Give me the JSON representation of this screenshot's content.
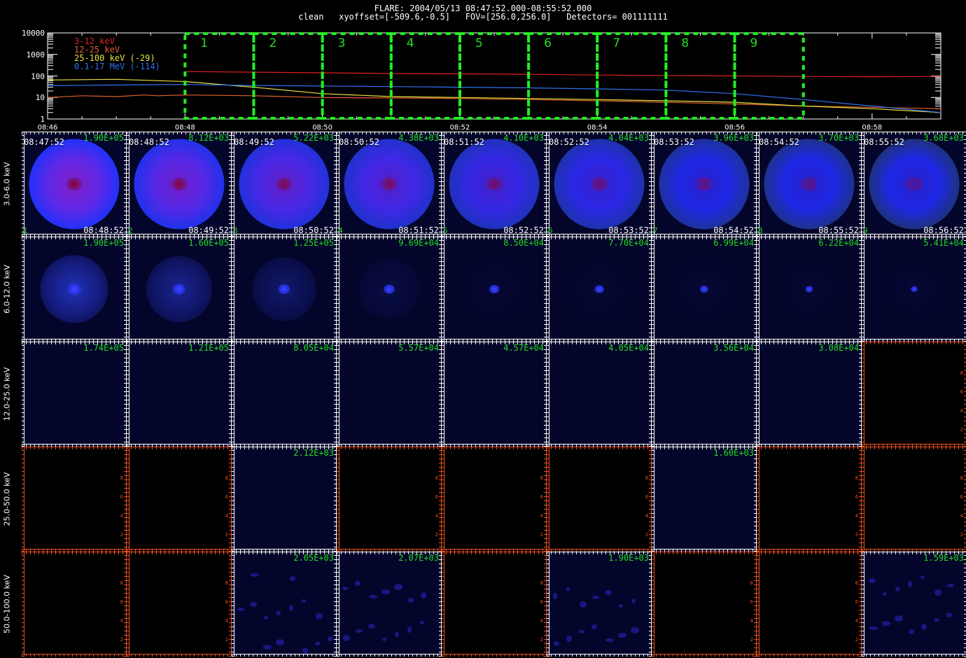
{
  "header": {
    "line1": "FLARE: 2004/05/13 08:47:52.000-08:55:52.000",
    "line2": "clean   xyoffset=[-509.6,-0.5]   FOV=[256.0,256.0]   Detectors= 001111111"
  },
  "chart_data": [
    {
      "type": "line",
      "x_axis": {
        "unit": "time",
        "range": [
          "08:46",
          "08:59"
        ],
        "tick_labels": [
          "08:46",
          "08:48",
          "08:50",
          "08:52",
          "08:54",
          "08:56",
          "08:58"
        ]
      },
      "y_axis": {
        "scale": "log",
        "range": [
          1,
          10000
        ],
        "tick_labels": [
          "1",
          "10",
          "100",
          "1000",
          "10000"
        ]
      },
      "series": [
        {
          "name": "3-12 keV",
          "color": "#dd2222",
          "x": [
            "08:46",
            "08:47",
            "08:48",
            "08:49",
            "08:50",
            "08:51",
            "08:52",
            "08:53",
            "08:54",
            "08:55",
            "08:56",
            "08:57",
            "08:58",
            "08:59"
          ],
          "values": [
            null,
            null,
            160,
            150,
            140,
            130,
            125,
            120,
            110,
            105,
            100,
            95,
            92,
            95
          ]
        },
        {
          "name": "12-25 keV",
          "color": "#e06030",
          "x": [
            "08:46",
            "08:46.5",
            "08:47",
            "08:47.4",
            "08:47.6",
            "08:48",
            "08:49",
            "08:50",
            "08:51",
            "08:52",
            "08:53",
            "08:54",
            "08:55",
            "08:56",
            "08:57",
            "08:58",
            "08:59"
          ],
          "values": [
            10,
            12,
            11,
            13,
            12,
            13,
            12,
            10,
            9.5,
            9,
            8,
            7,
            6,
            5,
            4,
            3.5,
            3
          ]
        },
        {
          "name": "25-100 keV (-29)",
          "color": "#e8e040",
          "x": [
            "08:46",
            "08:47",
            "08:48",
            "08:49",
            "08:50",
            "08:51",
            "08:52",
            "08:53",
            "08:54",
            "08:55",
            "08:56",
            "08:57",
            "08:58",
            "08:59"
          ],
          "values": [
            65,
            70,
            55,
            30,
            15,
            11,
            10,
            9,
            8,
            7,
            6,
            4,
            3,
            2
          ]
        },
        {
          "name": "0.1-17 MeV (-114)",
          "color": "#3070ee",
          "x": [
            "08:46",
            "08:47",
            "08:48",
            "08:49",
            "08:50",
            "08:51",
            "08:52",
            "08:53",
            "08:54",
            "08:55",
            "08:56",
            "08:57",
            "08:58",
            "08:59"
          ],
          "values": [
            35,
            38,
            40,
            36,
            34,
            32,
            30,
            28,
            25,
            22,
            15,
            8,
            4,
            2
          ]
        }
      ],
      "intervals": [
        "1",
        "2",
        "3",
        "4",
        "5",
        "6",
        "7",
        "8",
        "9"
      ],
      "interval_bounds": [
        "08:48",
        "08:49",
        "08:50",
        "08:51",
        "08:52",
        "08:53",
        "08:54",
        "08:55",
        "08:56",
        "08:57"
      ]
    },
    {
      "type": "heatmap",
      "columns": [
        {
          "index": "1",
          "start": "08:47:52",
          "end": "08:48:52"
        },
        {
          "index": "2",
          "start": "08:48:52",
          "end": "08:49:52"
        },
        {
          "index": "3",
          "start": "08:49:52",
          "end": "08:50:52"
        },
        {
          "index": "4",
          "start": "08:50:52",
          "end": "08:51:52"
        },
        {
          "index": "5",
          "start": "08:51:52",
          "end": "08:52:52"
        },
        {
          "index": "6",
          "start": "08:52:52",
          "end": "08:53:52"
        },
        {
          "index": "7",
          "start": "08:53:52",
          "end": "08:54:52"
        },
        {
          "index": "8",
          "start": "08:54:52",
          "end": "08:55:52"
        },
        {
          "index": "9",
          "start": "08:55:52",
          "end": "08:56:52"
        }
      ],
      "rows": [
        {
          "label": "3.0-6.0 keV",
          "peaks": [
            "1.90E+05",
            "8.12E+03",
            "5.22E+03",
            "4.38E+03",
            "4.10E+03",
            "4.04E+03",
            "3.96E+03",
            "3.70E+03",
            "3.68E+03"
          ]
        },
        {
          "label": "6.0-12.0 keV",
          "peaks": [
            "1.90E+05",
            "1.60E+05",
            "1.25E+05",
            "9.69E+04",
            "8.50E+04",
            "7.70E+04",
            "6.99E+04",
            "6.22E+04",
            "5.41E+04"
          ]
        },
        {
          "label": "12.0-25.0 keV",
          "peaks": [
            "1.74E+05",
            "1.21E+05",
            "8.05E+04",
            "5.57E+04",
            "4.57E+04",
            "4.05E+04",
            "3.56E+04",
            "3.08E+04",
            null
          ]
        },
        {
          "label": "25.0-50.0 keV",
          "peaks": [
            null,
            null,
            "2.12E+03",
            null,
            null,
            null,
            "1.60E+03",
            null,
            null
          ]
        },
        {
          "label": "50.0-100.0 keV",
          "peaks": [
            null,
            null,
            "2.05E+03",
            "2.07E+03",
            null,
            "1.90E+03",
            null,
            null,
            "1.59E+03"
          ]
        }
      ],
      "axis_tick_labels": [
        "2",
        "4",
        "6",
        "8"
      ]
    }
  ],
  "colors": {
    "interval_box": "#22ee22",
    "axis": "#e85020",
    "grid_axis": "#ffffff",
    "peak_text": "#22dd22"
  }
}
